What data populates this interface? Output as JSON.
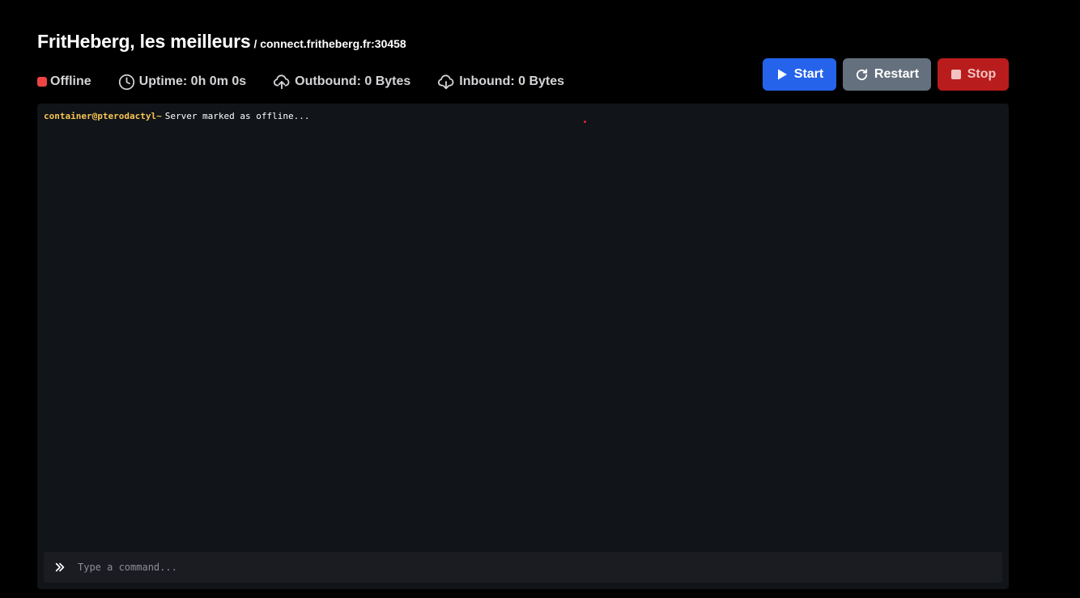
{
  "server": {
    "name": "FritHeberg, les meilleurs",
    "address": "/ connect.fritheberg.fr:30458"
  },
  "stats": {
    "status": "Offline",
    "status_color": "#ef4444",
    "uptime": "Uptime: 0h 0m 0s",
    "outbound": "Outbound: 0 Bytes",
    "inbound": "Inbound: 0 Bytes"
  },
  "actions": {
    "start": "Start",
    "restart": "Restart",
    "stop": "Stop",
    "start_color": "#2563eb",
    "restart_color": "#64707d",
    "stop_color": "#b91c1c"
  },
  "console": {
    "prompt": "container@pterodactyl~",
    "lines": [
      "Server marked as offline..."
    ],
    "command_placeholder": "Type a command..."
  },
  "icons": {
    "uptime": "clock-icon",
    "outbound": "cloud-upload-icon",
    "inbound": "cloud-download-icon",
    "start": "play-icon",
    "restart": "restart-icon",
    "stop": "stop-square-icon",
    "command": "chevron-double-right-icon"
  }
}
